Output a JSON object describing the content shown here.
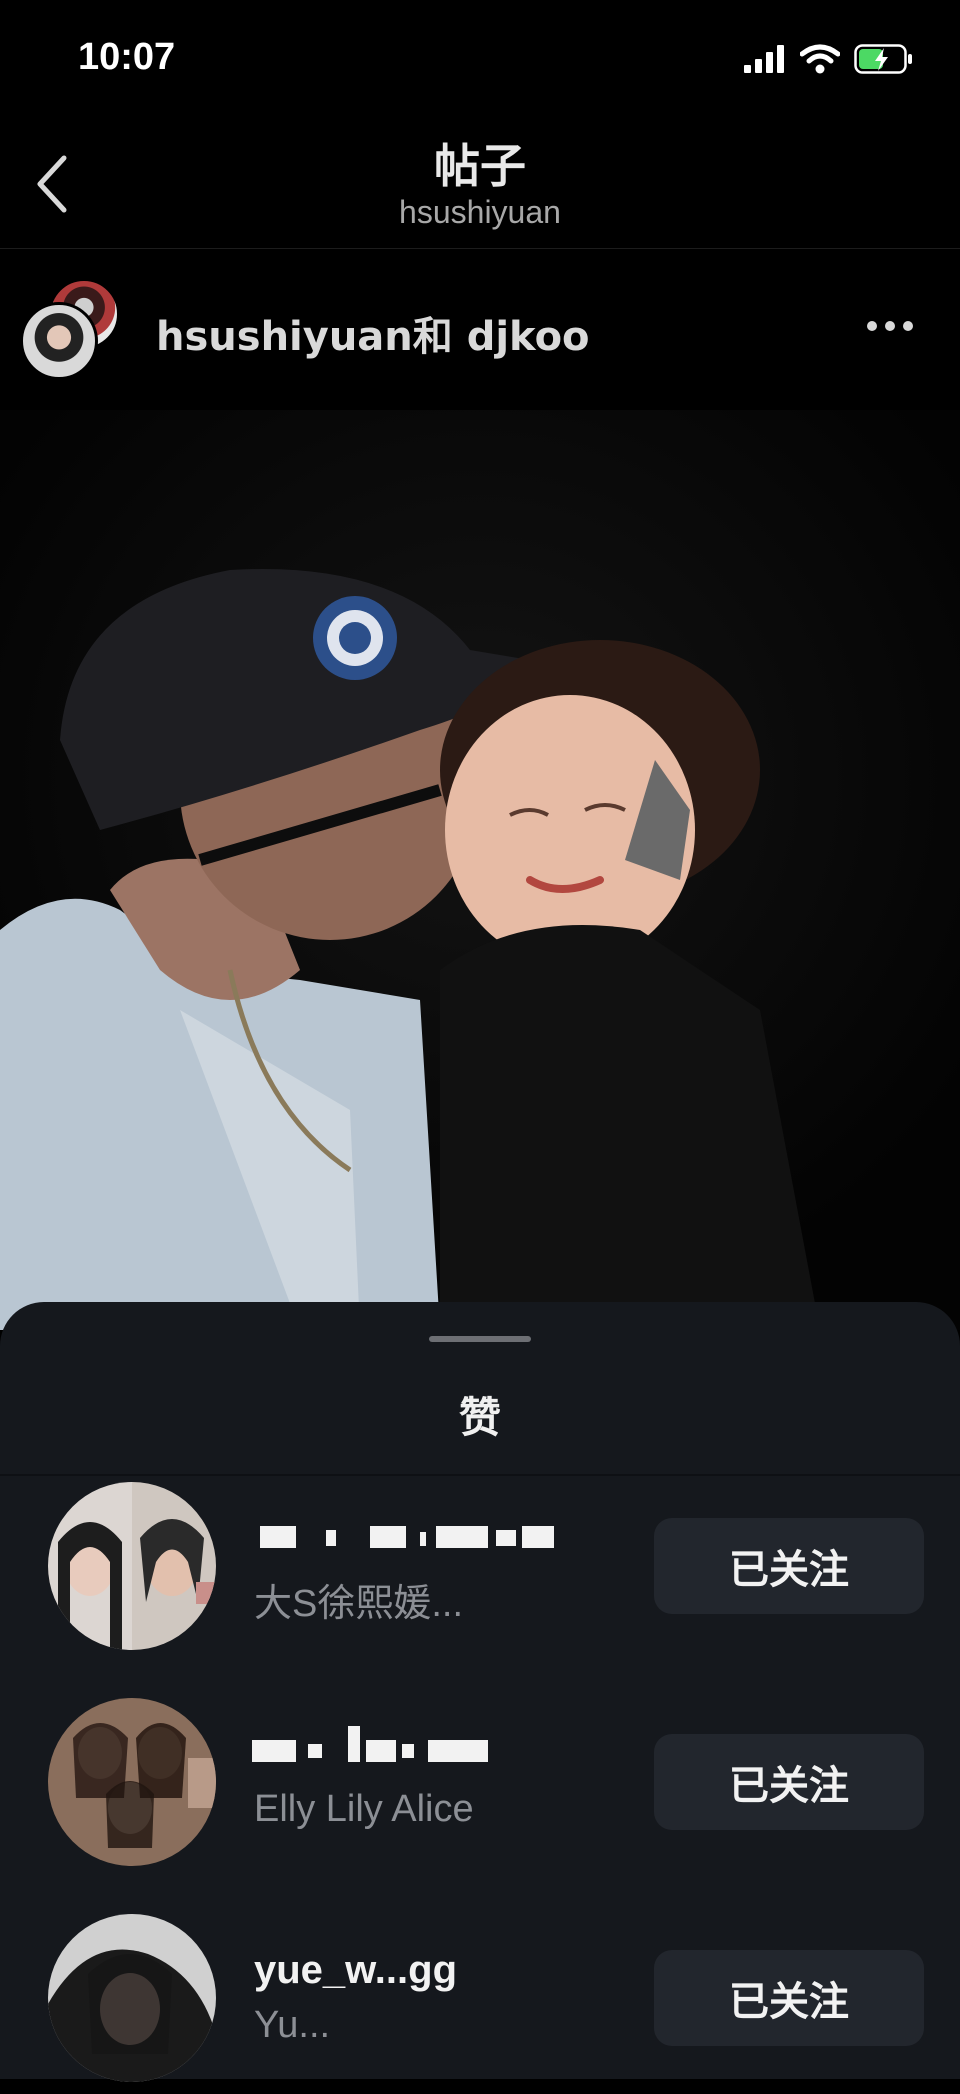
{
  "status_bar": {
    "time": "10:07"
  },
  "nav": {
    "title": "帖子",
    "subtitle": "hsushiyuan"
  },
  "post": {
    "authors": "hsushiyuan和 djkoo"
  },
  "likes_sheet": {
    "title": "赞",
    "users": [
      {
        "username": "",
        "fullname": "大S徐熙媛...",
        "follow_label": "已关注"
      },
      {
        "username": "",
        "fullname": "Elly Lily Alice",
        "follow_label": "已关注"
      },
      {
        "username": "yue_w...gg",
        "fullname": "Yu...",
        "follow_label": "已关注"
      }
    ]
  },
  "colors": {
    "background": "#000000",
    "sheet": "#15181d",
    "button": "#22262d",
    "secondary_text": "#8c8f95",
    "battery": "#4cd964"
  }
}
